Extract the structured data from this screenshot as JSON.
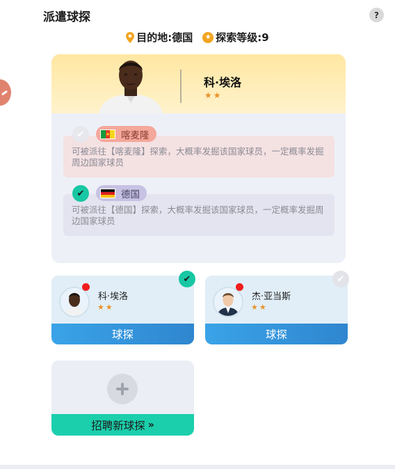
{
  "page": {
    "title": "派遣球探",
    "help_label": "?"
  },
  "header_info": {
    "destination_label": "目的地:德国",
    "level_label": "探索等级:9",
    "icons": [
      "location-pin-icon",
      "star-badge-icon"
    ]
  },
  "selected_scout": {
    "name": "科·埃洛",
    "stars": "★★",
    "star_count": 2
  },
  "regions": [
    {
      "name": "喀麦隆",
      "flag": "cameroon-flag-icon",
      "selected": false,
      "description": "可被派往【喀麦隆】探索，大概率发掘该国家球员，一定概率发掘周边国家球员"
    },
    {
      "name": "德国",
      "flag": "germany-flag-icon",
      "selected": true,
      "description": "可被派往【德国】探索，大概率发掘该国家球员，一定概率发掘周边国家球员"
    }
  ],
  "scouts": [
    {
      "name": "科·埃洛",
      "stars": "★★",
      "star_count": 2,
      "button": "球探",
      "selected": true
    },
    {
      "name": "杰·亚当斯",
      "stars": "★★",
      "star_count": 2,
      "button": "球探",
      "selected": false
    }
  ],
  "recruit": {
    "label": "招聘新球探",
    "chevron": "»"
  },
  "colors": {
    "accent_teal": "#18c7a3",
    "button_blue": "#3aa3e8",
    "star_orange": "#e8922a",
    "header_yellow": "#ffe7a2"
  }
}
